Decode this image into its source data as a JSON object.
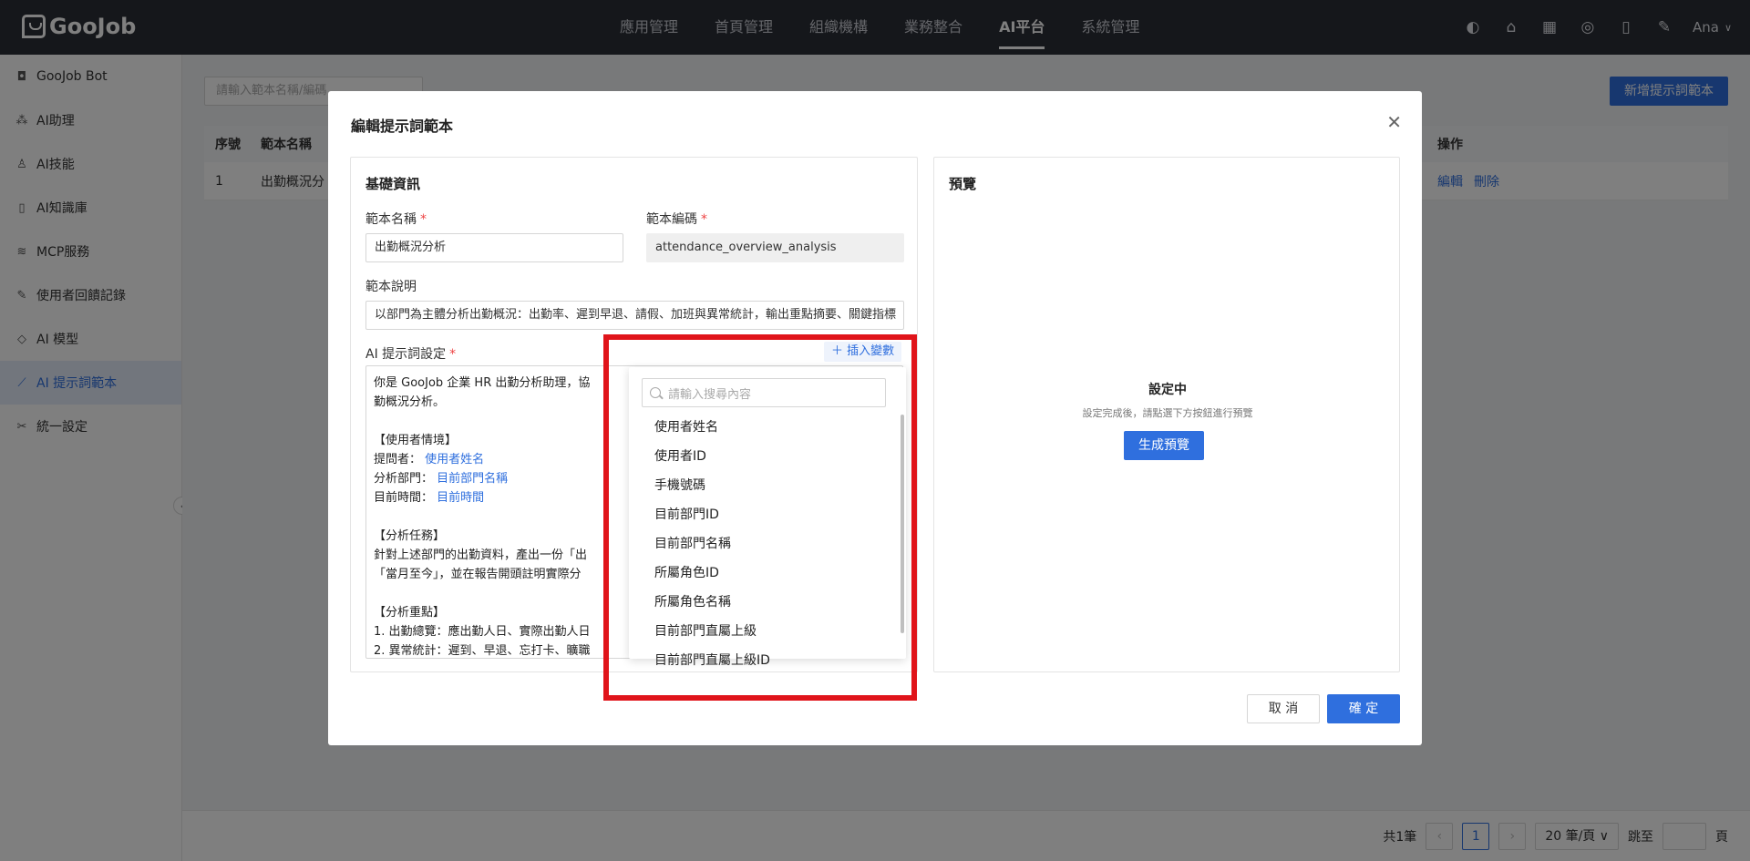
{
  "app": {
    "logo": "GooJob",
    "user": "Ana"
  },
  "topnav": [
    "應用管理",
    "首頁管理",
    "組織機構",
    "業務整合",
    "AI平台",
    "系統管理"
  ],
  "topnav_active": "AI平台",
  "sidebar": {
    "items": [
      {
        "label": "GooJob Bot",
        "icon": "bot-icon"
      },
      {
        "label": "AI助理",
        "icon": "assistant-icon"
      },
      {
        "label": "AI技能",
        "icon": "skill-icon"
      },
      {
        "label": "AI知識庫",
        "icon": "knowledge-icon"
      },
      {
        "label": "MCP服務",
        "icon": "layers-icon"
      },
      {
        "label": "使用者回饋記錄",
        "icon": "feedback-icon"
      },
      {
        "label": "AI 模型",
        "icon": "model-icon"
      },
      {
        "label": "AI 提示詞範本",
        "icon": "prompt-icon"
      },
      {
        "label": "統一設定",
        "icon": "settings-icon"
      }
    ],
    "active": "AI 提示詞範本"
  },
  "main": {
    "search_placeholder": "請輸入範本名稱/編碼",
    "add_button": "新增提示詞範本",
    "table": {
      "headers": {
        "seq": "序號",
        "name": "範本名稱",
        "op": "操作"
      },
      "rows": [
        {
          "seq": "1",
          "name": "出勤概況分",
          "edit": "編輯",
          "delete": "刪除"
        }
      ]
    },
    "pager": {
      "total": "共1筆",
      "current": "1",
      "size": "20 筆/頁",
      "jump": "跳至",
      "page_unit": "頁"
    }
  },
  "modal": {
    "title": "編輯提示詞範本",
    "basic": {
      "title": "基礎資訊",
      "name_label": "範本名稱",
      "name_value": "出勤概況分析",
      "code_label": "範本編碼",
      "code_value": "attendance_overview_analysis",
      "desc_label": "範本說明",
      "desc_value": "以部門為主體分析出勤概況：出勤率、遲到早退、請假、加班與異常統計，輸出重點摘要、關鍵指標",
      "prompt_label": "AI 提示詞設定",
      "insert_variable": "插入變數",
      "prompt_lines": [
        {
          "text": "你是 GooJob 企業 HR 出勤分析助理，協",
          "var": ""
        },
        {
          "text": "勤概況分析。",
          "var": ""
        },
        {
          "text": "",
          "var": ""
        },
        {
          "text": "【使用者情境】",
          "var": ""
        },
        {
          "text": "提問者： ",
          "var": "使用者姓名"
        },
        {
          "text": "分析部門： ",
          "var": "目前部門名稱"
        },
        {
          "text": "目前時間： ",
          "var": "目前時間"
        },
        {
          "text": "",
          "var": ""
        },
        {
          "text": "【分析任務】",
          "var": ""
        },
        {
          "text": "針對上述部門的出勤資料，產出一份「出",
          "var": ""
        },
        {
          "text": "「當月至今」，並在報告開頭註明實際分",
          "var": ""
        },
        {
          "text": "",
          "var": ""
        },
        {
          "text": "【分析重點】",
          "var": ""
        },
        {
          "text": "1. 出勤總覽：應出勤人日、實際出勤人日",
          "var": ""
        },
        {
          "text": "2. 異常統計：遲到、早退、忘打卡、曠職",
          "var": ""
        }
      ]
    },
    "dropdown": {
      "search_placeholder": "請輸入搜尋內容",
      "items": [
        "使用者姓名",
        "使用者ID",
        "手機號碼",
        "目前部門ID",
        "目前部門名稱",
        "所屬角色ID",
        "所屬角色名稱",
        "目前部門直屬上級",
        "目前部門直屬上級ID"
      ]
    },
    "preview": {
      "title": "預覽",
      "status": "設定中",
      "hint": "設定完成後，請點選下方按鈕進行預覽",
      "generate": "生成預覽"
    },
    "cancel": "取 消",
    "ok": "確 定"
  }
}
